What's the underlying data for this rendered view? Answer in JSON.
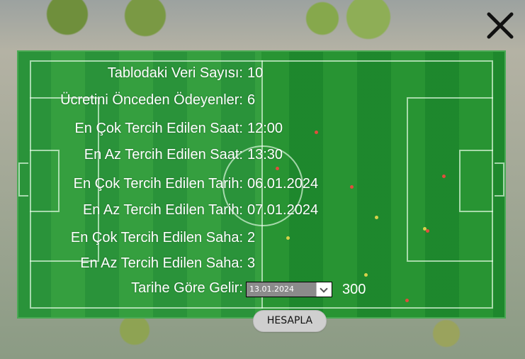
{
  "window": {
    "close_icon": "close-icon"
  },
  "stats": [
    {
      "label": "Tablodaki Veri Sayısı:",
      "value": "10"
    },
    {
      "label": "Ücretini Önceden Ödeyenler:",
      "value": "6"
    },
    {
      "label": "En Çok Tercih Edilen Saat:",
      "value": "12:00"
    },
    {
      "label": "En Az Tercih Edilen Saat:",
      "value": "13:30"
    },
    {
      "label": "En Çok Tercih Edilen Tarih:",
      "value": "06.01.2024"
    },
    {
      "label": "En Az Tercih Edilen Tarih:",
      "value": "07.01.2024"
    },
    {
      "label": "En Çok Tercih Edilen Saha:",
      "value": "2"
    },
    {
      "label": "En Az Tercih Edilen Saha:",
      "value": "3"
    }
  ],
  "income": {
    "label": "Tarihe Göre Gelir:",
    "selected_date": "13.01.2024",
    "value": "300"
  },
  "actions": {
    "calculate_label": "HESAPLA"
  },
  "colors": {
    "pitch_green": "#2a9a35",
    "text": "#ffffff",
    "button": "#cfcfcf"
  }
}
